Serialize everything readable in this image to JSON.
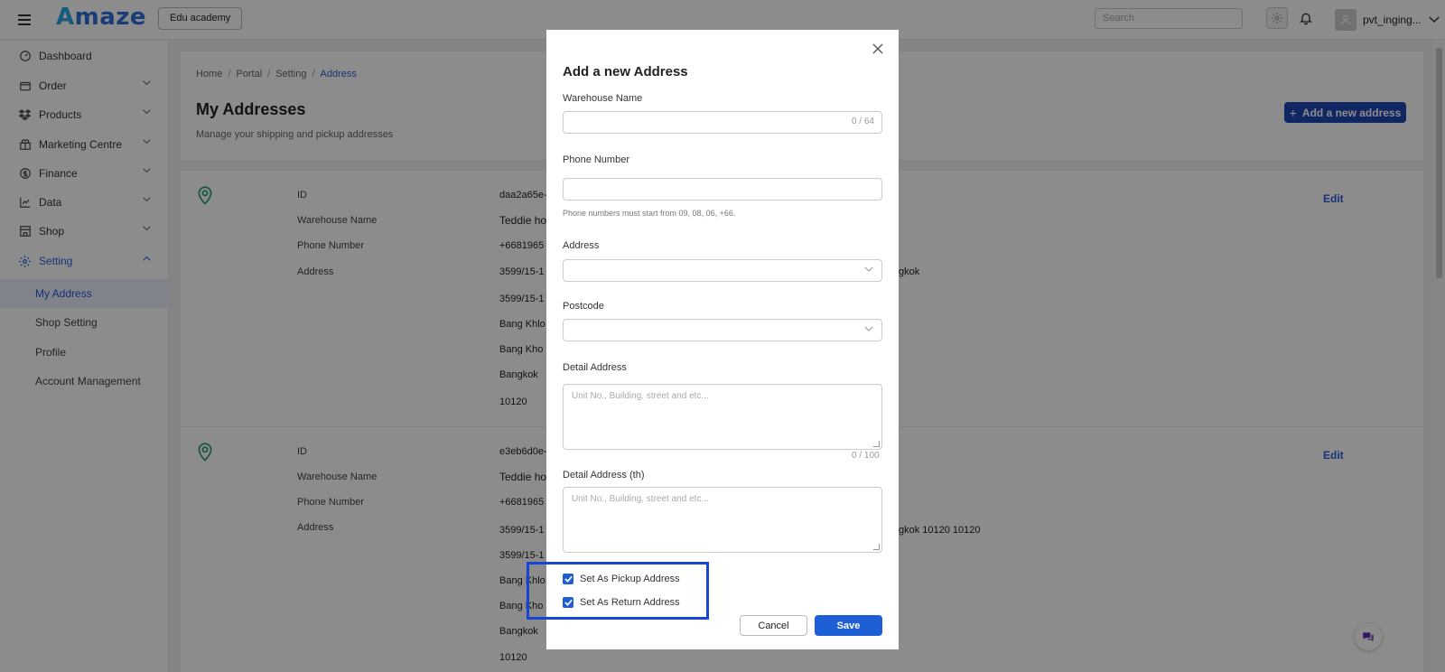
{
  "header": {
    "logo": "Amaze",
    "logo_first": "A",
    "logo_rest": "maze",
    "workspace": "Edu academy",
    "search_placeholder": "Search",
    "username": "pvt_inging..."
  },
  "sidebar": {
    "items": [
      {
        "label": "Dashboard",
        "icon": "dashboard-icon"
      },
      {
        "label": "Order",
        "icon": "order-icon"
      },
      {
        "label": "Products",
        "icon": "products-icon"
      },
      {
        "label": "Marketing Centre",
        "icon": "marketing-icon"
      },
      {
        "label": "Finance",
        "icon": "finance-icon"
      },
      {
        "label": "Data",
        "icon": "data-icon"
      },
      {
        "label": "Shop",
        "icon": "shop-icon"
      },
      {
        "label": "Setting",
        "icon": "gear-icon"
      }
    ],
    "sub_items": [
      {
        "label": "My Address"
      },
      {
        "label": "Shop Setting"
      },
      {
        "label": "Profile"
      },
      {
        "label": "Account Management"
      }
    ]
  },
  "main": {
    "breadcrumb": [
      "Home",
      "Portal",
      "Setting",
      "Address"
    ],
    "breadcrumb_sep": "/",
    "title": "My Addresses",
    "subtitle": "Manage your shipping and pickup addresses",
    "add_button": "Add a new address",
    "labels": {
      "id": "ID",
      "warehouse": "Warehouse Name",
      "phone": "Phone Number",
      "address": "Address"
    },
    "edit_label": "Edit",
    "cards": [
      {
        "id": "daa2a65e-",
        "warehouse": "Teddie ho",
        "phone": "+6681965",
        "address_lines": [
          "3599/15-1",
          "3599/15-1",
          "Bang Khlo",
          "Bang Kho L",
          "Bangkok",
          "10120"
        ],
        "address_tail": "gkok"
      },
      {
        "id": "e3eb6d0e-",
        "warehouse": "Teddie ho",
        "phone": "+6681965",
        "address_lines": [
          "3599/15-1",
          "3599/15-1",
          "Bang Khlo",
          "Bang Kho L",
          "Bangkok",
          "10120"
        ],
        "address_tail": "gkok 10120 10120"
      }
    ]
  },
  "modal": {
    "title": "Add a new Address",
    "warehouse_label": "Warehouse Name",
    "warehouse_counter": "0 / 64",
    "phone_label": "Phone Number",
    "phone_hint": "Phone numbers must start from 09, 08, 06, +66.",
    "address_label": "Address",
    "postcode_label": "Postcode",
    "detail_label": "Detail Address",
    "detail_placeholder": "Unit No., Building, street and etc...",
    "detail_counter": "0 / 100",
    "detail_th_label": "Detail Address (th)",
    "detail_th_placeholder": "Unit No., Building, street and etc...",
    "pickup_label": "Set As Pickup Address",
    "return_label": "Set As Return Address",
    "cancel": "Cancel",
    "save": "Save"
  },
  "colors": {
    "accent": "#1f5fd6",
    "primary_dark": "#1f47b7",
    "highlight": "#1746d6",
    "pin": "#2a9d7a"
  }
}
